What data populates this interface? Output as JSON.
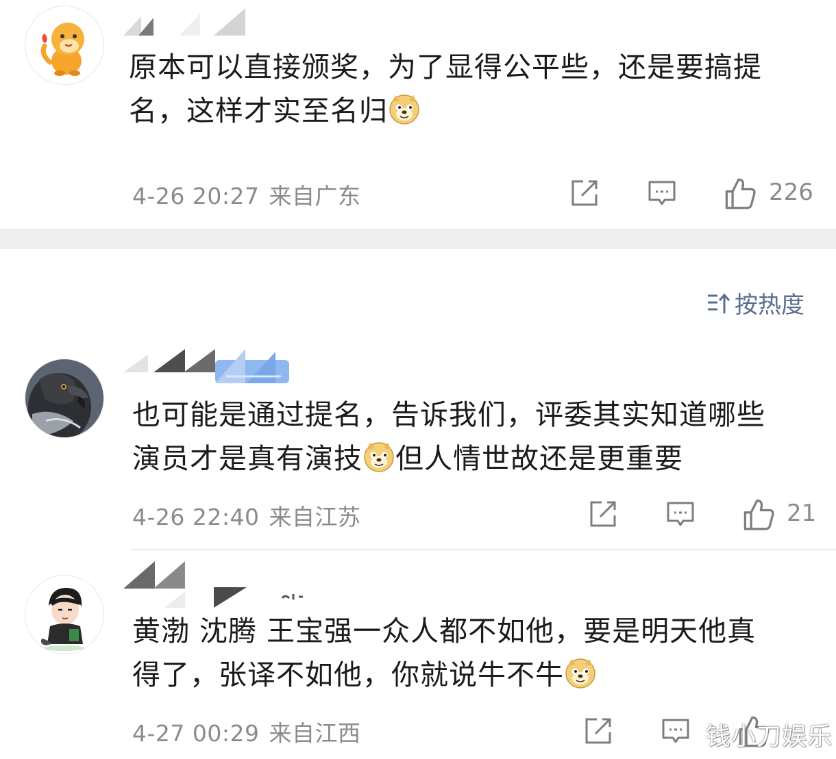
{
  "comments": [
    {
      "text_line1": "原本可以直接颁奖，为了显得公平些，还是要搞提",
      "text_line2": "名，这样才实至名归",
      "date": "4-26 20:27",
      "location": "来自广东",
      "likes": "226",
      "avatar": "cartoon-dinosaur-avatar"
    },
    {
      "text_line1": "也可能是通过提名，告诉我们，评委其实知道哪些",
      "text_line2a": "演员才是真有演技",
      "text_line2b": "但人情世故还是更重要",
      "date": "4-26 22:40",
      "location": "来自江苏",
      "likes": "21",
      "avatar": "eagle-photo-avatar"
    },
    {
      "text_line1": "黄渤 沈腾 王宝强一众人都不如他，要是明天他真",
      "text_line2": "得了，张译不如他，你就说牛不牛",
      "date": "4-27 00:29",
      "location": "来自江西",
      "avatar": "cartoon-boy-avatar"
    }
  ],
  "sort_label": "按热度",
  "watermark": "钱小刀娱乐",
  "colors": {
    "text": "#1b1b1b",
    "meta": "#8b8b8b",
    "sort": "#566f8f",
    "band": "#efefef"
  },
  "icons": {
    "share": "share-icon",
    "reply": "comment-icon",
    "like": "thumbs-up-icon",
    "emoji": "doge-emoji",
    "sort": "sort-icon"
  }
}
